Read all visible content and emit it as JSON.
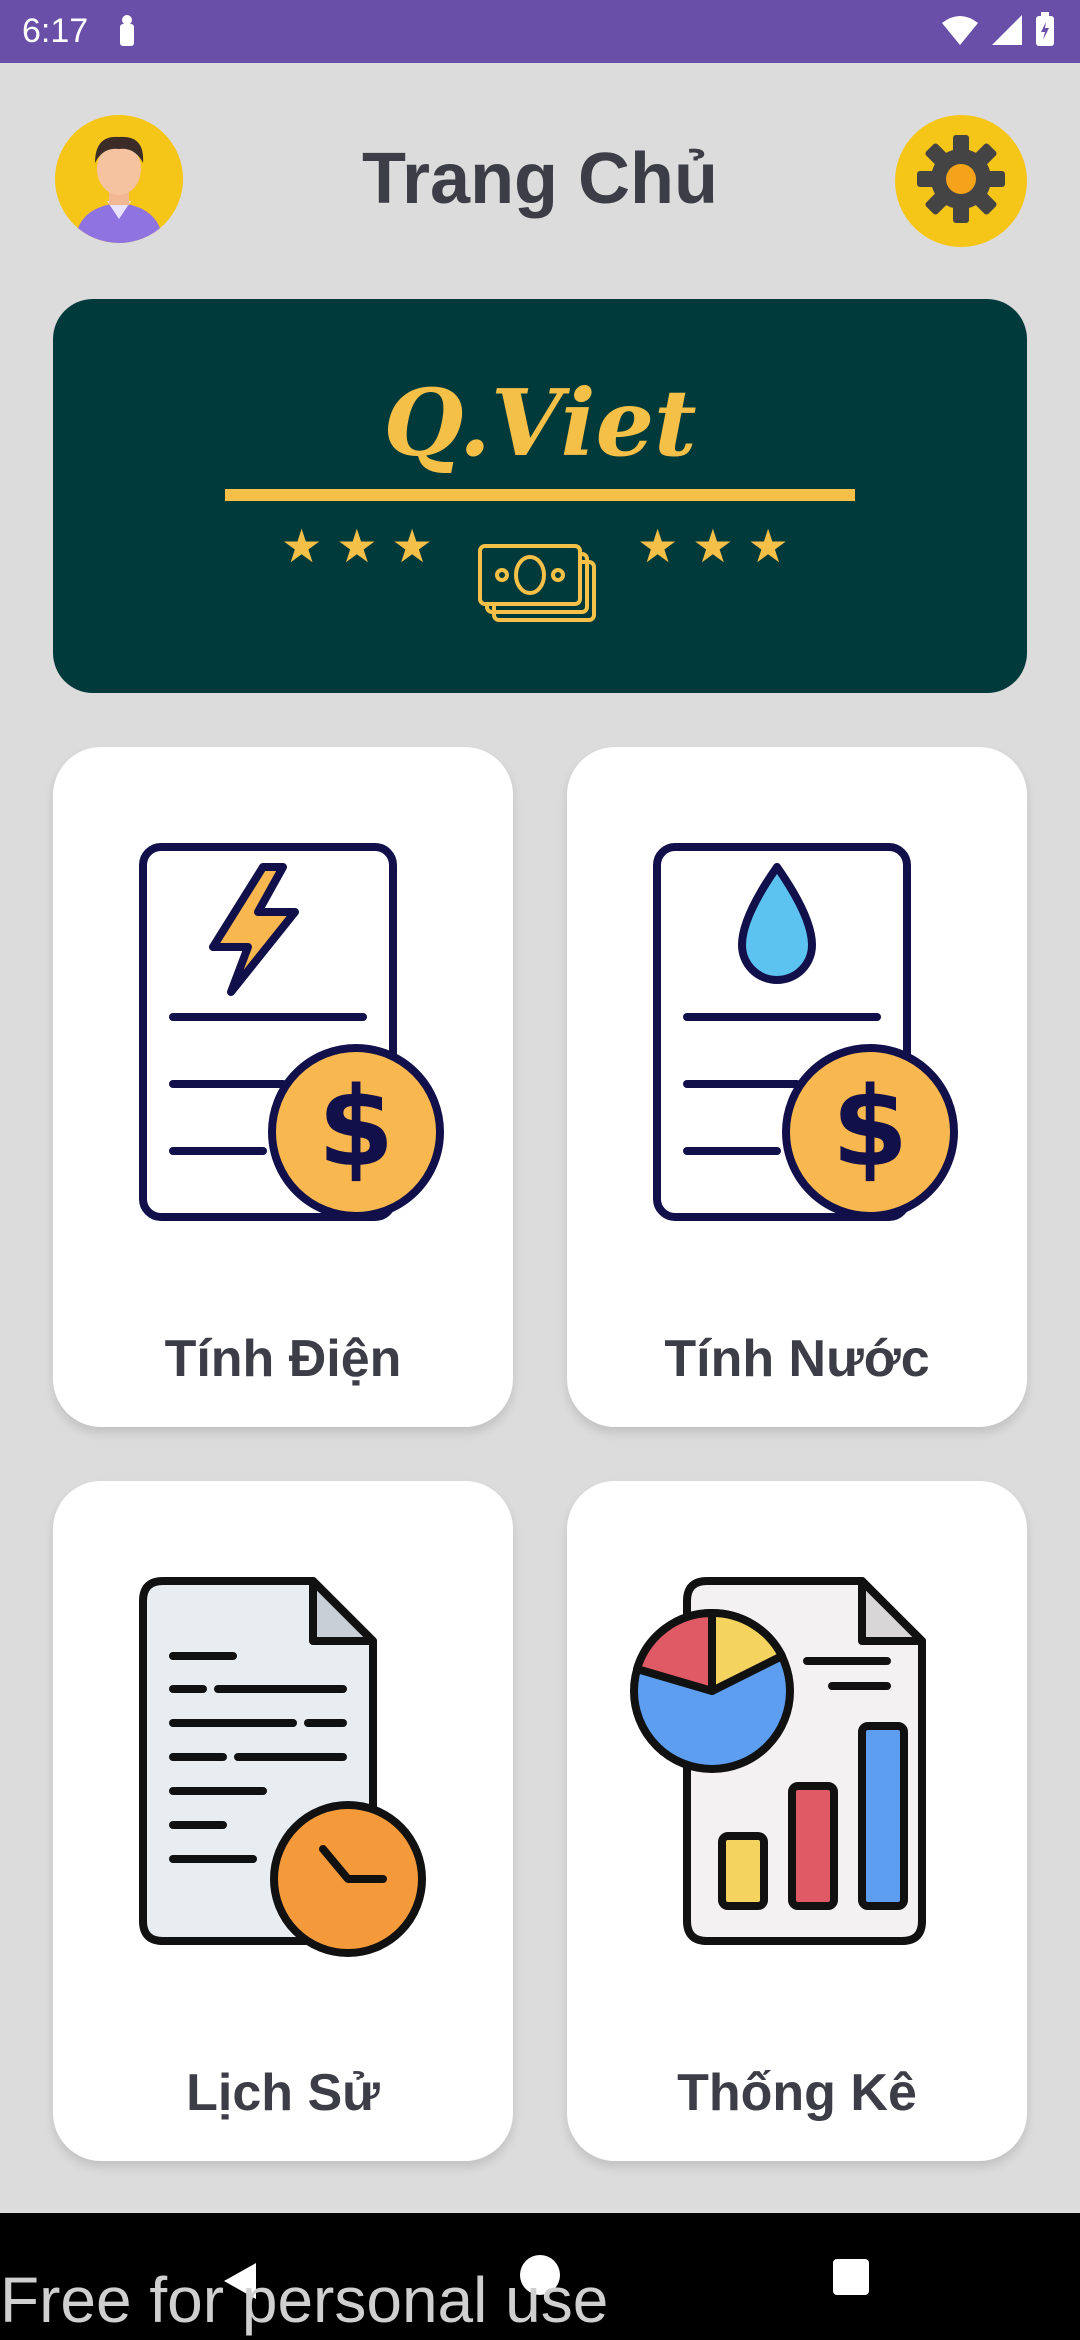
{
  "status_bar": {
    "time": "6:17"
  },
  "header": {
    "title": "Trang Chủ"
  },
  "banner": {
    "brand": "Q.Viet"
  },
  "cards": [
    {
      "label": "Tính Điện"
    },
    {
      "label": "Tính Nước"
    },
    {
      "label": "Lịch Sử"
    },
    {
      "label": "Thống Kê"
    }
  ],
  "watermark": "Free for personal use",
  "colors": {
    "status_bar": "#6a4fa8",
    "banner_bg": "#003a3a",
    "accent_gold": "#f5c048",
    "background": "#dcdcdc"
  }
}
